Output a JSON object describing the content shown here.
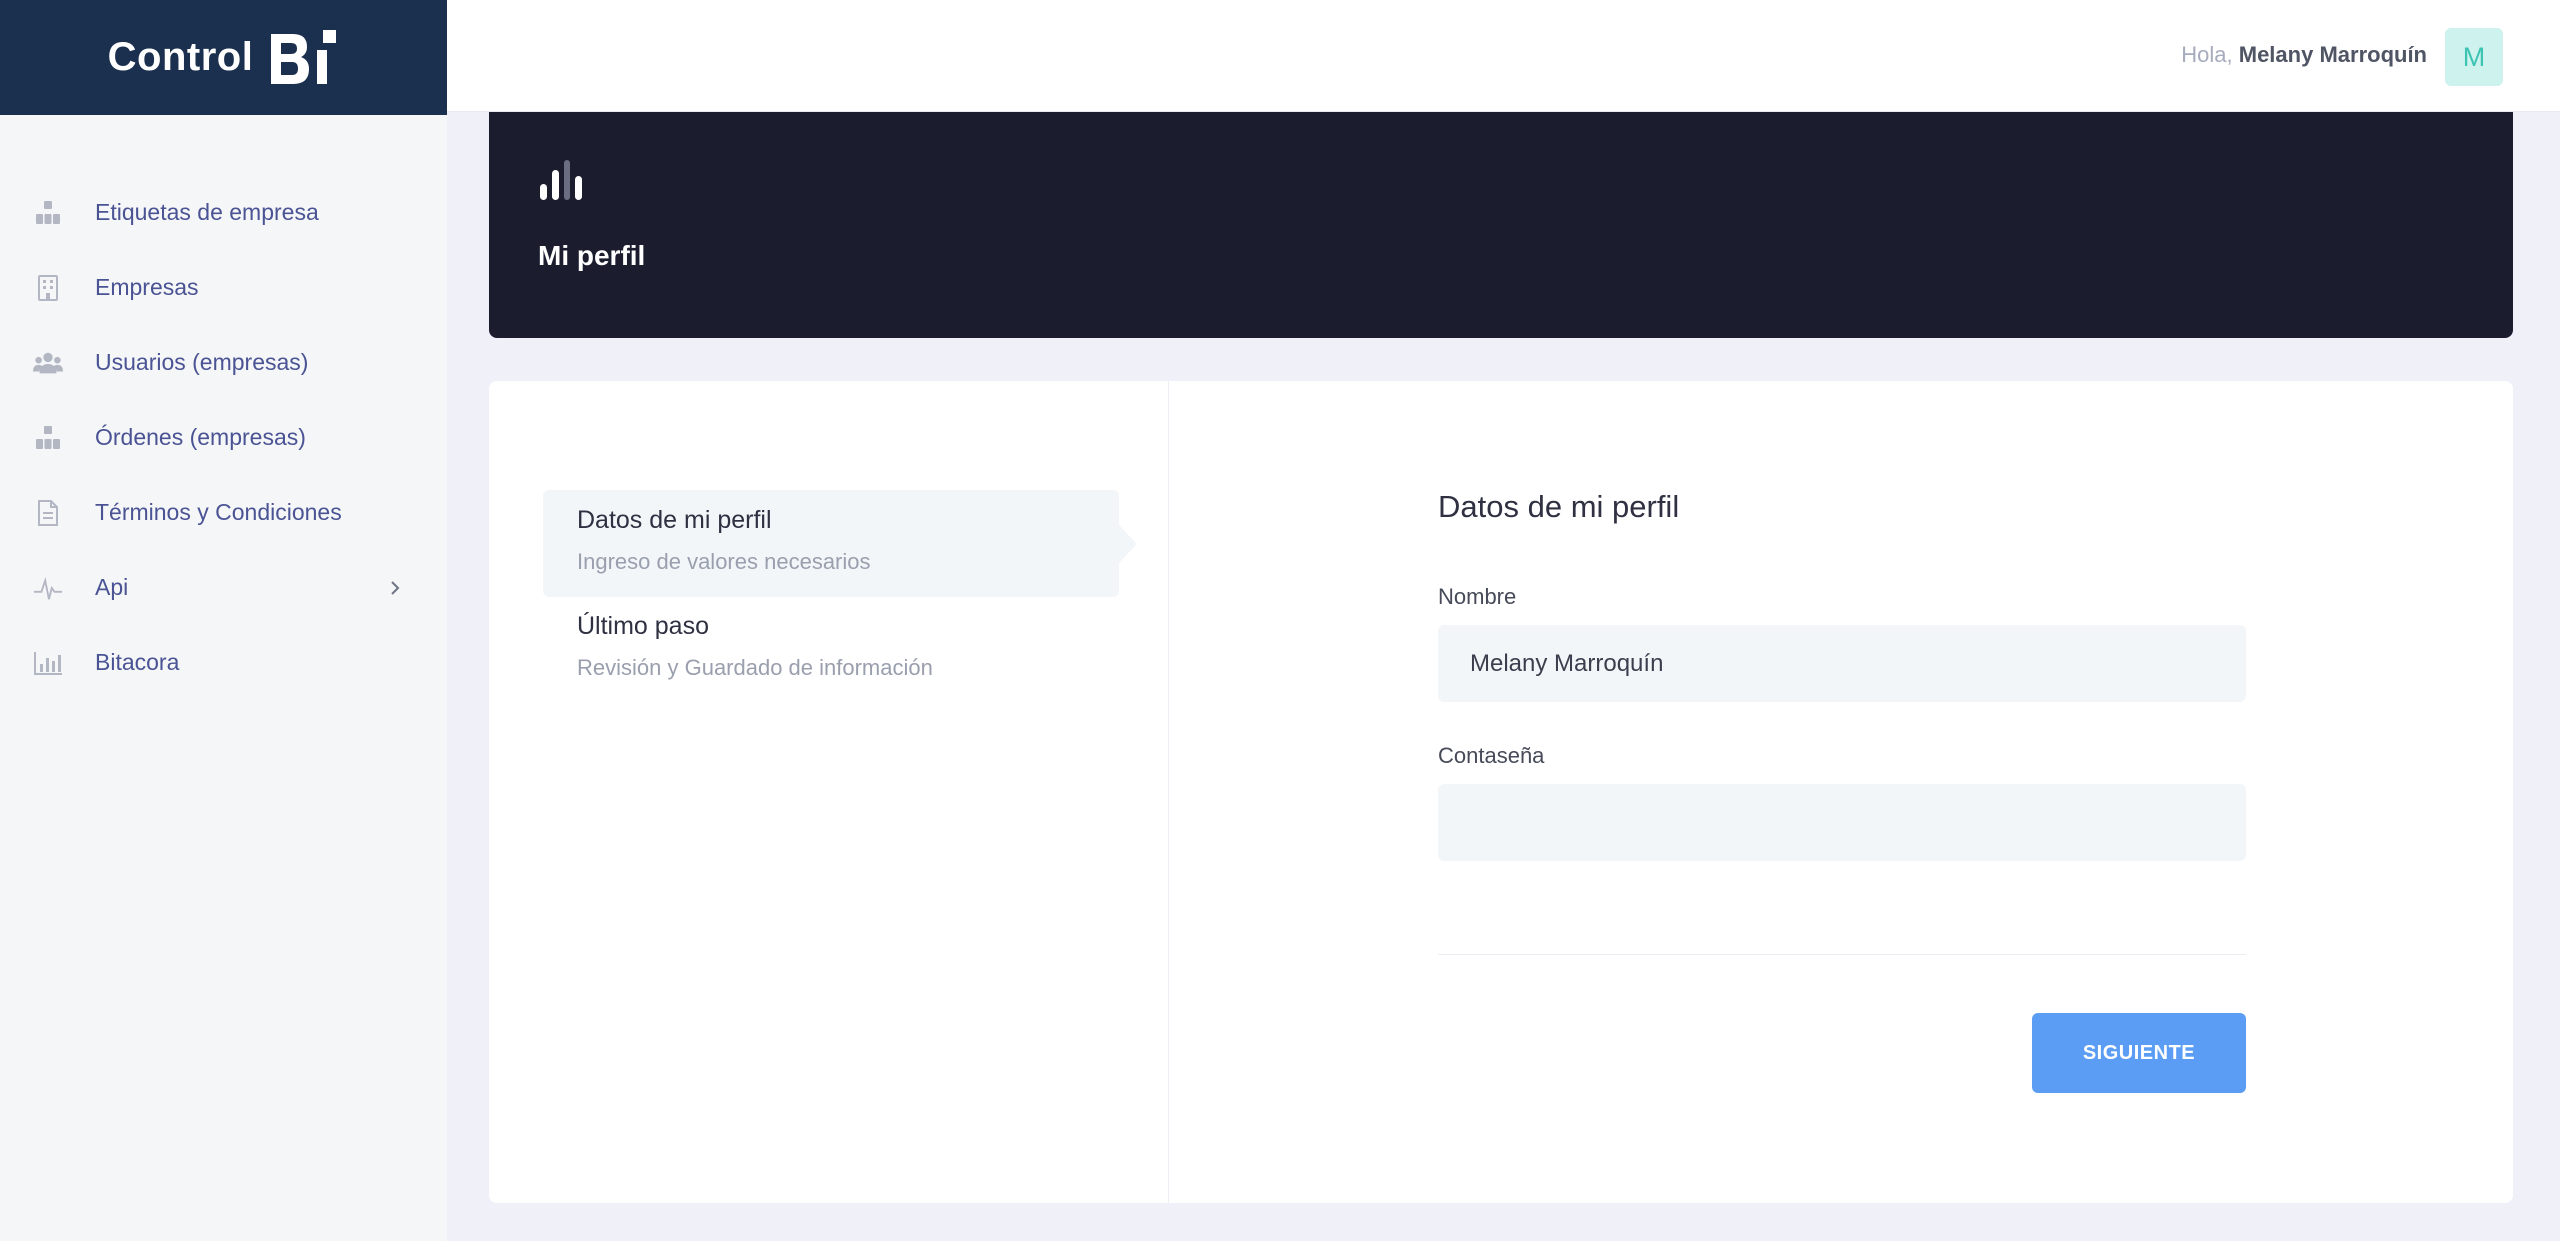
{
  "brand": {
    "word": "Control",
    "mark": "Bi"
  },
  "sidebar": {
    "items": [
      {
        "label": "Etiquetas de empresa",
        "icon": "tags-grid-icon"
      },
      {
        "label": "Empresas",
        "icon": "building-icon"
      },
      {
        "label": "Usuarios (empresas)",
        "icon": "users-icon"
      },
      {
        "label": "Órdenes (empresas)",
        "icon": "orders-grid-icon"
      },
      {
        "label": "Términos y Condiciones",
        "icon": "document-icon"
      },
      {
        "label": "Api",
        "icon": "pulse-icon",
        "has_submenu": true
      },
      {
        "label": "Bitacora",
        "icon": "bar-chart-icon"
      }
    ]
  },
  "topbar": {
    "greeting": "Hola, ",
    "user_name": "Melany Marroquín",
    "avatar_initial": "M"
  },
  "header": {
    "title": "Mi perfil",
    "icon": "bar-chart-icon"
  },
  "steps": [
    {
      "title": "Datos de mi perfil",
      "subtitle": "Ingreso de valores necesarios",
      "active": true
    },
    {
      "title": "Último paso",
      "subtitle": "Revisión y Guardado de información",
      "active": false
    }
  ],
  "form": {
    "title": "Datos de mi perfil",
    "name_label": "Nombre",
    "name_value": "Melany Marroquín",
    "password_label": "Contaseña",
    "password_value": "",
    "next_label": "SIGUIENTE"
  },
  "colors": {
    "brand_bar": "#1b2f4f",
    "banner": "#1b1d2f",
    "nav_text": "#4a5394",
    "primary_button": "#5b9cf4",
    "avatar_bg": "#cef3ef",
    "avatar_text": "#3cc3b1"
  }
}
